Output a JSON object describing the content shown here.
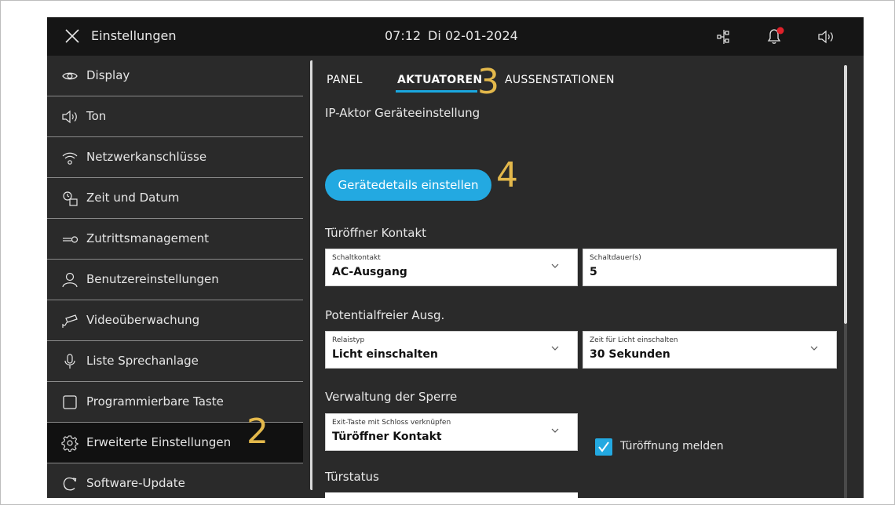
{
  "topbar": {
    "title": "Einstellungen",
    "time": "07:12",
    "date": "Di 02-01-2024",
    "icons": [
      "close-icon",
      "network-icon",
      "notification-bell-icon",
      "speaker-icon"
    ],
    "notification_color": "#e0212a"
  },
  "sidebar": {
    "items": [
      {
        "label": "Display",
        "icon": "eye-icon"
      },
      {
        "label": "Ton",
        "icon": "speaker-icon"
      },
      {
        "label": "Netzwerkanschlüsse",
        "icon": "wifi-icon"
      },
      {
        "label": "Zeit und Datum",
        "icon": "clock-calendar-icon"
      },
      {
        "label": "Zutrittsmanagement",
        "icon": "key-icon"
      },
      {
        "label": "Benutzereinstellungen",
        "icon": "user-icon"
      },
      {
        "label": "Videoüberwachung",
        "icon": "camera-icon"
      },
      {
        "label": "Liste Sprechanlage",
        "icon": "microphone-icon"
      },
      {
        "label": "Programmierbare Taste",
        "icon": "square-button-icon"
      },
      {
        "label": "Erweiterte Einstellungen",
        "icon": "gear-icon",
        "active": true
      },
      {
        "label": "Software-Update",
        "icon": "refresh-icon"
      }
    ],
    "callout": "2"
  },
  "main": {
    "tabs": [
      {
        "label": "PANEL"
      },
      {
        "label": "AKTUATOREN",
        "active": true
      },
      {
        "label": "AUSSENSTATIONEN"
      }
    ],
    "tab_callout": "3",
    "device_section": "IP-Aktor Geräteeinstellung",
    "device_button": "Gerätedetails einstellen",
    "button_callout": "4",
    "door_section": "Türöffner Kontakt",
    "switch_contact": {
      "label": "Schaltkontakt",
      "value": "AC-Ausgang"
    },
    "switch_duration": {
      "label": "Schaltdauer(s)",
      "value": "5"
    },
    "relay_section": "Potentialfreier Ausg.",
    "relay_type": {
      "label": "Relaistyp",
      "value": "Licht einschalten"
    },
    "light_time": {
      "label": "Zeit für Licht einschalten",
      "value": "30 Sekunden"
    },
    "lock_section": "Verwaltung der Sperre",
    "exit_key": {
      "label": "Exit-Taste mit Schloss verknüpfen",
      "value": "Türöffner Kontakt"
    },
    "report_checkbox": {
      "label": "Türöffnung melden",
      "checked": true
    },
    "door_status_section": "Türstatus"
  },
  "colors": {
    "accent": "#23a9e1",
    "callout": "#e3b84b",
    "background": "#2a2a2a",
    "topbar": "#151515"
  }
}
